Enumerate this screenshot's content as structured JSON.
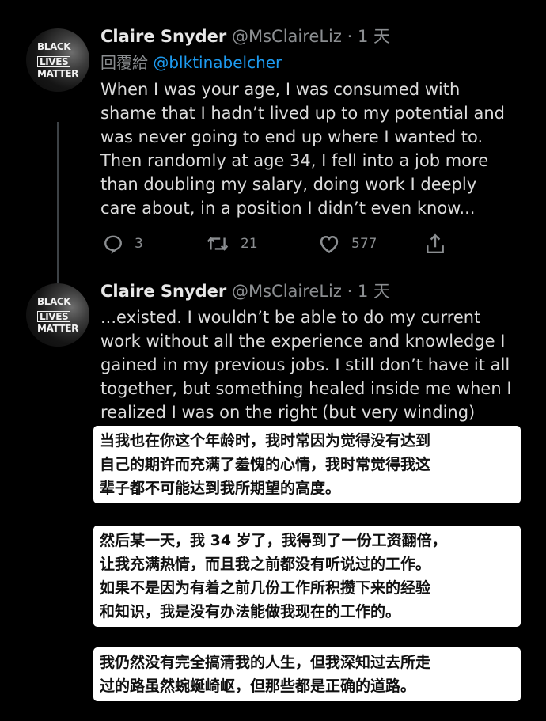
{
  "tweets": [
    {
      "avatar_text": [
        "BLACK",
        "LIVES",
        "MATTER"
      ],
      "name": "Claire Snyder",
      "handle": "@MsClaireLiz",
      "separator": "·",
      "time": "1 天",
      "reply_prefix": "回覆給",
      "reply_mention": "@blktinabelcher",
      "body": "When I was your age, I was consumed with\nshame that I hadn’t lived up to my potential and\nwas never going to end up where I wanted to.\nThen randomly at age 34, I fell into a job more\nthan doubling my salary, doing work I deeply\ncare about, in a position I didn’t even know...",
      "replies": "3",
      "retweets": "21",
      "likes": "577"
    },
    {
      "avatar_text": [
        "BLACK",
        "LIVES",
        "MATTER"
      ],
      "name": "Claire Snyder",
      "handle": "@MsClaireLiz",
      "separator": "·",
      "time": "1 天",
      "body": "...existed. I wouldn’t be able to do my current\nwork without all the experience and knowledge I\ngained in my previous jobs. I still don’t have it all\ntogether, but something healed inside me when I\nrealized I was on the right (but very winding)"
    }
  ],
  "captions": [
    "当我也在你这个年龄时，我时常因为觉得没有达到\n自己的期许而充满了羞愧的心情，我时常觉得我这\n辈子都不可能达到我所期望的高度。",
    "然后某一天，我 34 岁了，我得到了一份工资翻倍，\n让我充满热情，而且我之前都没有听说过的工作。\n如果不是因为有着之前几份工作所积攒下来的经验\n和知识，我是没有办法能做我现在的工作的。",
    "我仍然没有完全搞清我的人生，但我深知过去所走\n过的路虽然蜿蜒崎岖，但那些都是正确的道路。"
  ],
  "colors": {
    "background": "#000000",
    "mention": "#1d9bf0",
    "muted": "#8b8e91",
    "caption_bg": "#ffffff"
  },
  "icons": [
    "reply-icon",
    "retweet-icon",
    "like-icon",
    "share-icon"
  ]
}
